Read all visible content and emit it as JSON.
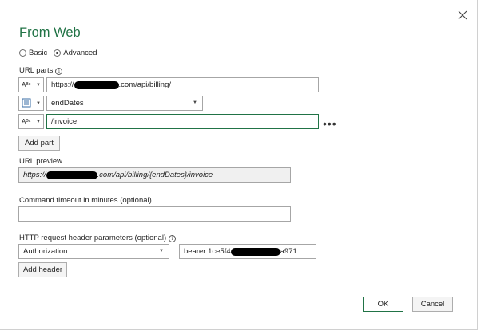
{
  "dialog": {
    "title": "From Web",
    "mode": {
      "basic_label": "Basic",
      "advanced_label": "Advanced",
      "selected": "Advanced"
    },
    "url_parts": {
      "label": "URL parts",
      "parts": [
        {
          "type_icon": "text-type-icon",
          "glyph": "Aᴮᶜ",
          "prefix": "https://",
          "suffix": ".com/api/billing/"
        },
        {
          "type_icon": "parameter-type-icon",
          "value": "endDates"
        },
        {
          "type_icon": "text-type-icon",
          "glyph": "Aᴮᶜ",
          "value": "/invoice"
        }
      ],
      "add_part_label": "Add part"
    },
    "url_preview": {
      "label": "URL preview",
      "prefix": "https://",
      "suffix": ".com/api/billing/{endDates}/invoice"
    },
    "command_timeout": {
      "label": "Command timeout in minutes (optional)",
      "value": ""
    },
    "http_headers": {
      "label": "HTTP request header parameters (optional)",
      "name": "Authorization",
      "value_prefix": "bearer 1ce5f4",
      "value_suffix": "a971",
      "add_header_label": "Add header"
    },
    "ok_label": "OK",
    "cancel_label": "Cancel"
  }
}
